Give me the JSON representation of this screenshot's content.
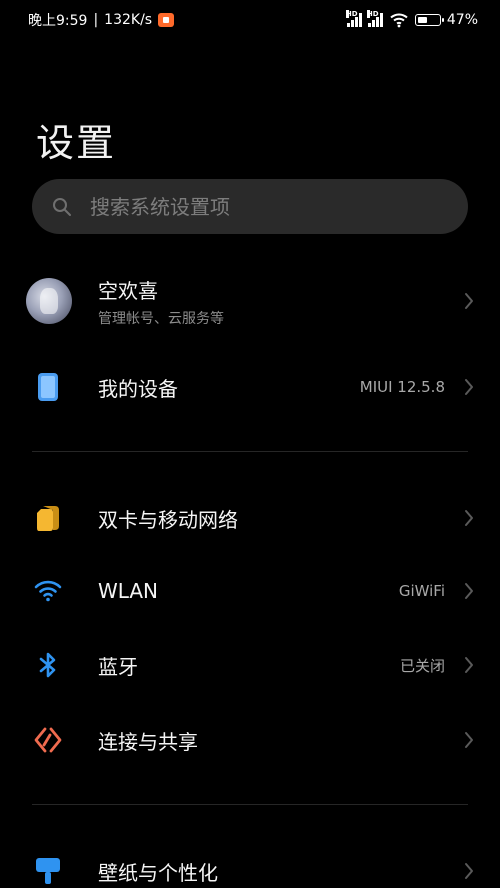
{
  "status_bar": {
    "time": "晚上9:59",
    "separator": "|",
    "speed": "132K/s",
    "battery_pct": "47%",
    "battery_level": 0.47,
    "signal_label": "HD"
  },
  "page": {
    "title": "设置"
  },
  "search": {
    "placeholder": "搜索系统设置项"
  },
  "account": {
    "name": "空欢喜",
    "subtitle": "管理帐号、云服务等"
  },
  "device": {
    "label": "我的设备",
    "value": "MIUI 12.5.8"
  },
  "network": {
    "sim_label": "双卡与移动网络",
    "wlan_label": "WLAN",
    "wlan_value": "GiWiFi",
    "bluetooth_label": "蓝牙",
    "bluetooth_value": "已关闭",
    "connect_label": "连接与共享"
  },
  "display": {
    "wallpaper_label": "壁纸与个性化"
  },
  "colors": {
    "background": "#000000",
    "sim_icon": "#f5b731",
    "wlan_icon": "#2f93f0",
    "bluetooth_icon": "#2f93f0",
    "connect_icon": "#ef6b4f",
    "device_icon": "#4a9cf0",
    "wallpaper_icon": "#2f93f0"
  },
  "icons": {
    "search": "search-icon",
    "device": "phone-icon",
    "sim": "sim-card-icon",
    "wlan": "wifi-icon",
    "bluetooth": "bluetooth-icon",
    "connect": "connection-share-icon",
    "wallpaper": "wallpaper-icon",
    "chevron": "chevron-right-icon"
  }
}
